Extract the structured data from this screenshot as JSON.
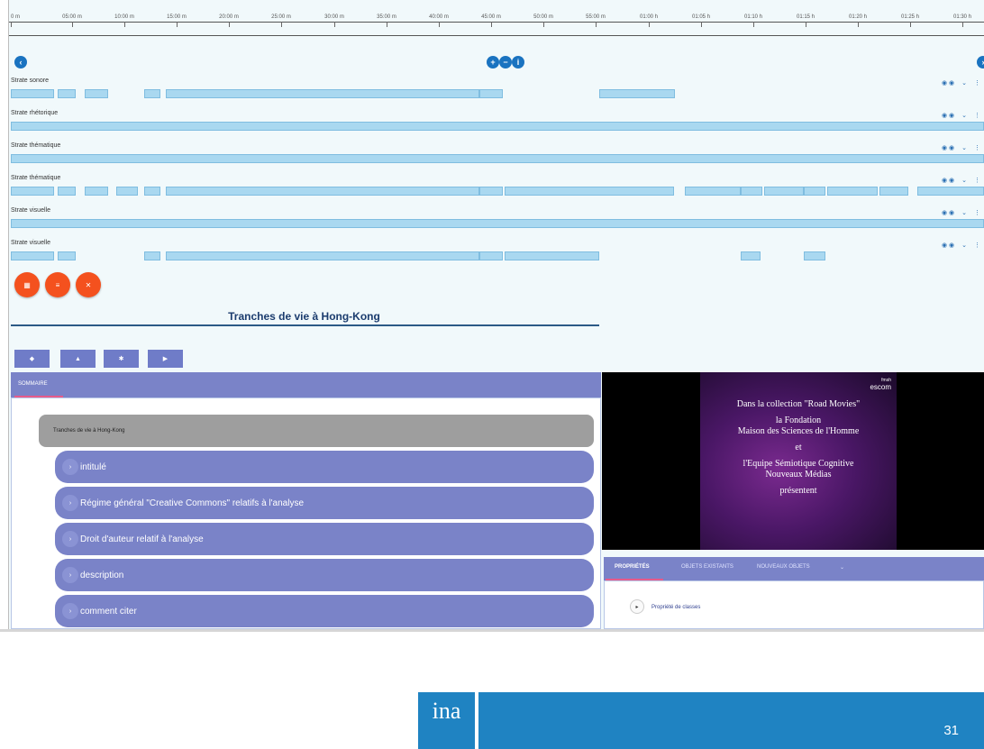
{
  "ruler": {
    "labels": [
      "0 m",
      "05:00 m",
      "10:00 m",
      "15:00 m",
      "20:00 m",
      "25:00 m",
      "30:00 m",
      "35:00 m",
      "40:00 m",
      "45:00 m",
      "50:00 m",
      "55:00 m",
      "01:00 h",
      "01:05 h",
      "01:10 h",
      "01:15 h",
      "01:20 h",
      "01:25 h",
      "01:30 h"
    ]
  },
  "nav": {
    "prev_icon": "chevron-left-icon",
    "next_icon": "chevron-right-icon",
    "zoom_in": "+",
    "zoom_out": "−",
    "zoom_reset": "i"
  },
  "strates": [
    {
      "name": "Strate sonore"
    },
    {
      "name": "Strate rhétorique"
    },
    {
      "name": "Strate thématique"
    },
    {
      "name": "Strate thématique"
    },
    {
      "name": "Strate visuelle"
    },
    {
      "name": "Strate visuelle"
    }
  ],
  "strate_controls": {
    "icons": "◉ ◉",
    "expand": "⌄",
    "more": "⋮"
  },
  "action_buttons": {
    "a": "▦",
    "b": "≡",
    "c": "✕"
  },
  "doc": {
    "title": "Tranches de vie à Hong-Kong"
  },
  "toolbar": {
    "b1": "◆",
    "b2": "▲",
    "b3": "✱",
    "b4": "▶"
  },
  "sommaire": {
    "tab": "SOMMAIRE",
    "root": "Tranches de vie à Hong-Kong",
    "items": [
      "intitulé",
      "Régime général \"Creative Commons\" relatifs à l'analyse",
      "Droit d'auteur relatif à l'analyse",
      "description",
      "comment citer"
    ]
  },
  "video": {
    "logo_small": "fmsh",
    "logo": "escom",
    "lines": [
      "Dans la collection \"Road Movies\"",
      "",
      "la Fondation",
      "Maison des Sciences de l'Homme",
      "",
      "et",
      "",
      "l'Equipe Sémiotique Cognitive",
      "Nouveaux Médias",
      "",
      "présentent"
    ]
  },
  "properties": {
    "tabs": [
      "PROPRIÉTÉS",
      "OBJETS EXISTANTS",
      "NOUVEAUX OBJETS"
    ],
    "item": "Propriété de classes"
  },
  "footer": {
    "logo": "ina",
    "page": "31"
  },
  "colors": {
    "accent": "#1a73c0",
    "panel": "#7a83c8",
    "segment": "#a9d8f0",
    "orange": "#f4511e",
    "footer": "#1f83c2"
  }
}
